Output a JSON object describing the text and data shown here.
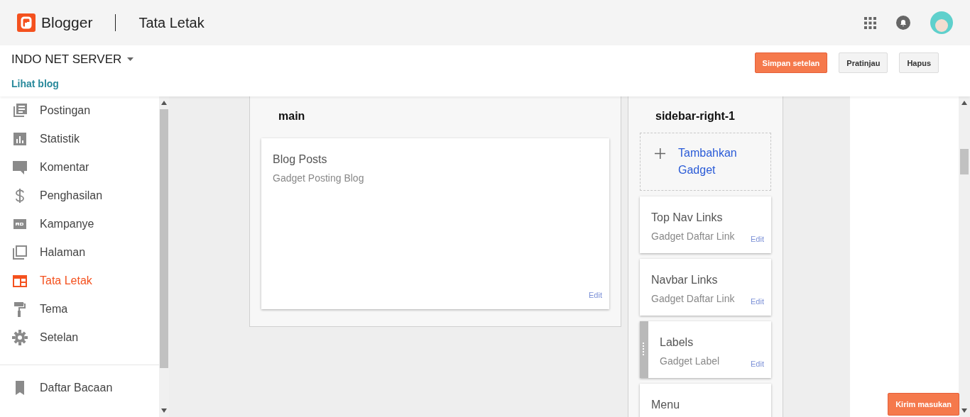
{
  "header": {
    "brand": "Blogger",
    "page_title": "Tata Letak"
  },
  "blog": {
    "name": "INDO NET SERVER",
    "view_link": "Lihat blog"
  },
  "actions": [
    {
      "label": "Simpan setelan",
      "kind": "primary"
    },
    {
      "label": "Pratinjau",
      "kind": "default"
    },
    {
      "label": "Hapus",
      "kind": "default"
    }
  ],
  "sidebar": {
    "items": [
      {
        "label": "Postingan",
        "selected": false
      },
      {
        "label": "Statistik",
        "selected": false
      },
      {
        "label": "Komentar",
        "selected": false
      },
      {
        "label": "Penghasilan",
        "selected": false
      },
      {
        "label": "Kampanye",
        "selected": false
      },
      {
        "label": "Halaman",
        "selected": false
      },
      {
        "label": "Tata Letak",
        "selected": true
      },
      {
        "label": "Tema",
        "selected": false
      },
      {
        "label": "Setelan",
        "selected": false
      }
    ],
    "secondary_items": [
      {
        "label": "Daftar Bacaan",
        "selected": false
      }
    ]
  },
  "sections": [
    {
      "title": "main",
      "gadgets": [
        {
          "title": "Blog Posts",
          "subtitle": "Gadget Posting Blog",
          "edit": "Edit",
          "dragging": false
        }
      ]
    },
    {
      "title": "sidebar-right-1",
      "add_gadget": "Tambahkan Gadget",
      "gadgets": [
        {
          "title": "Top Nav Links",
          "subtitle": "Gadget Daftar Link",
          "edit": "Edit",
          "dragging": false
        },
        {
          "title": "Navbar Links",
          "subtitle": "Gadget Daftar Link",
          "edit": "Edit",
          "dragging": false
        },
        {
          "title": "Labels",
          "subtitle": "Gadget Label",
          "edit": "Edit",
          "dragging": true
        },
        {
          "title": "Menu"
        }
      ]
    }
  ],
  "feedback_button": "Kirim masukan"
}
